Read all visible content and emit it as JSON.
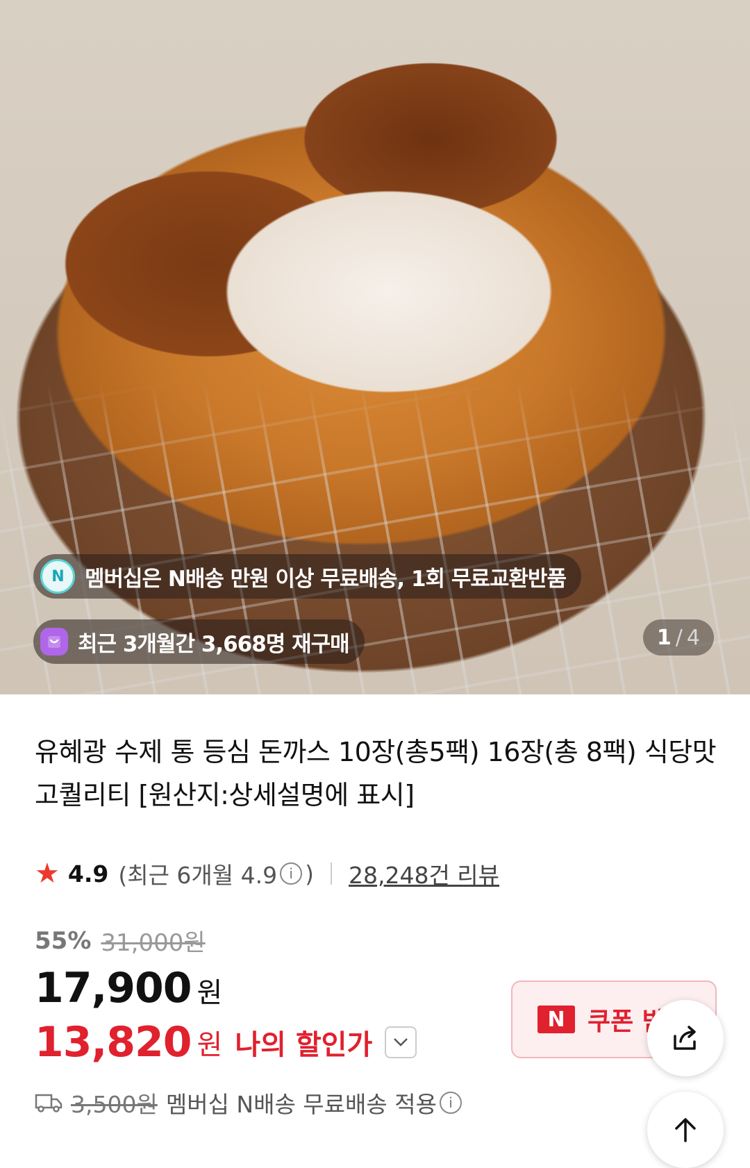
{
  "hero": {
    "membership_text": "멤버십은 N배송 만원 이상 무료배송, 1회 무료교환반품",
    "membership_icon": "N",
    "repurchase_text": "최근 3개월간 3,668명 재구매",
    "page_current": "1",
    "page_separator": "/",
    "page_total": "4"
  },
  "product": {
    "title": "유혜광 수제 통 등심 돈까스 10장(총5팩) 16장(총 8팩) 식당맛 고퀄리티 [원산지:상세설명에 표시]",
    "rating": "4.9",
    "rating_detail_prefix": "(최근 6개월 4.9",
    "rating_detail_suffix": ")",
    "review_count": "28,248건 리뷰",
    "discount_rate": "55%",
    "original_price": "31,000원",
    "price": "17,900",
    "price_unit": "원",
    "my_price": "13,820",
    "my_price_unit": "원",
    "my_price_label": "나의 할인가",
    "coupon_badge": "N",
    "coupon_label": "쿠폰 받기",
    "shipping_fee": "3,500원",
    "shipping_text": "멤버십 N배송 무료배송 적용"
  },
  "colors": {
    "accent_red": "#e0212e",
    "star": "#ea3b2e"
  }
}
